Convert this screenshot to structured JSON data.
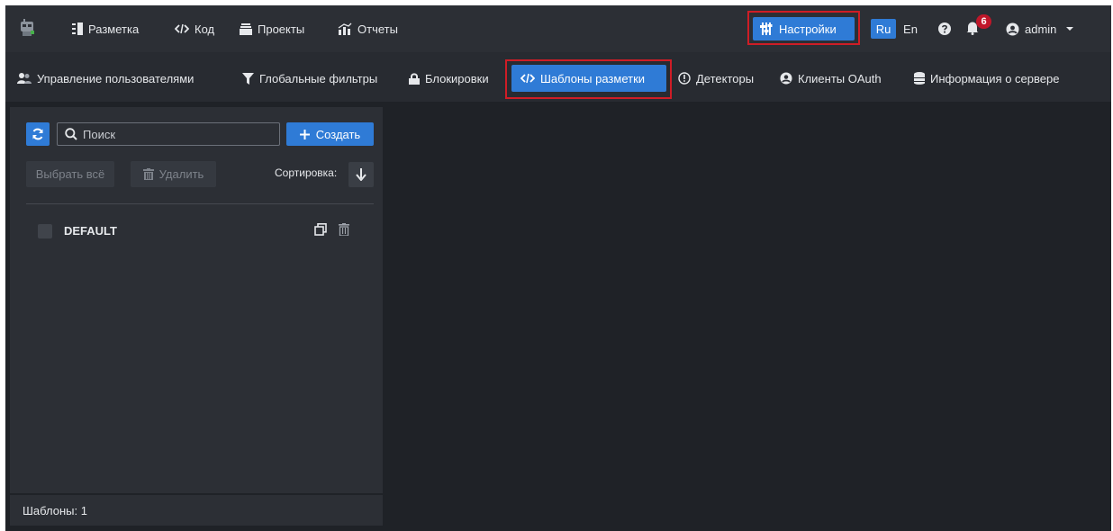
{
  "colors": {
    "accent": "#2f7bd6",
    "highlight": "#cf1d26",
    "badge": "#c0172a"
  },
  "topbar": {
    "logo_icon": "robot-logo-icon",
    "nav": [
      {
        "label": "Разметка",
        "icon": "markup-icon"
      },
      {
        "label": "Код",
        "icon": "code-icon"
      },
      {
        "label": "Проекты",
        "icon": "projects-icon"
      },
      {
        "label": "Отчеты",
        "icon": "reports-icon"
      }
    ],
    "settings_label": "Настройки",
    "lang_ru": "Ru",
    "lang_en": "En",
    "notifications_count": "6",
    "user_name": "admin"
  },
  "subnav": {
    "items": [
      {
        "label": "Управление пользователями",
        "icon": "users-icon"
      },
      {
        "label": "Глобальные фильтры",
        "icon": "filter-icon"
      },
      {
        "label": "Блокировки",
        "icon": "lock-icon"
      },
      {
        "label": "Шаблоны разметки",
        "icon": "code-icon"
      },
      {
        "label": "Детекторы",
        "icon": "detector-icon"
      },
      {
        "label": "Клиенты OAuth",
        "icon": "user-circle-icon"
      },
      {
        "label": "Информация о сервере",
        "icon": "database-icon"
      }
    ],
    "active_index": 3
  },
  "panel": {
    "search_placeholder": "Поиск",
    "create_label": "Создать",
    "select_all_label": "Выбрать всё",
    "delete_label": "Удалить",
    "sort_label": "Сортировка:",
    "templates": [
      {
        "name": "DEFAULT"
      }
    ],
    "footer_text": "Шаблоны: 1"
  }
}
